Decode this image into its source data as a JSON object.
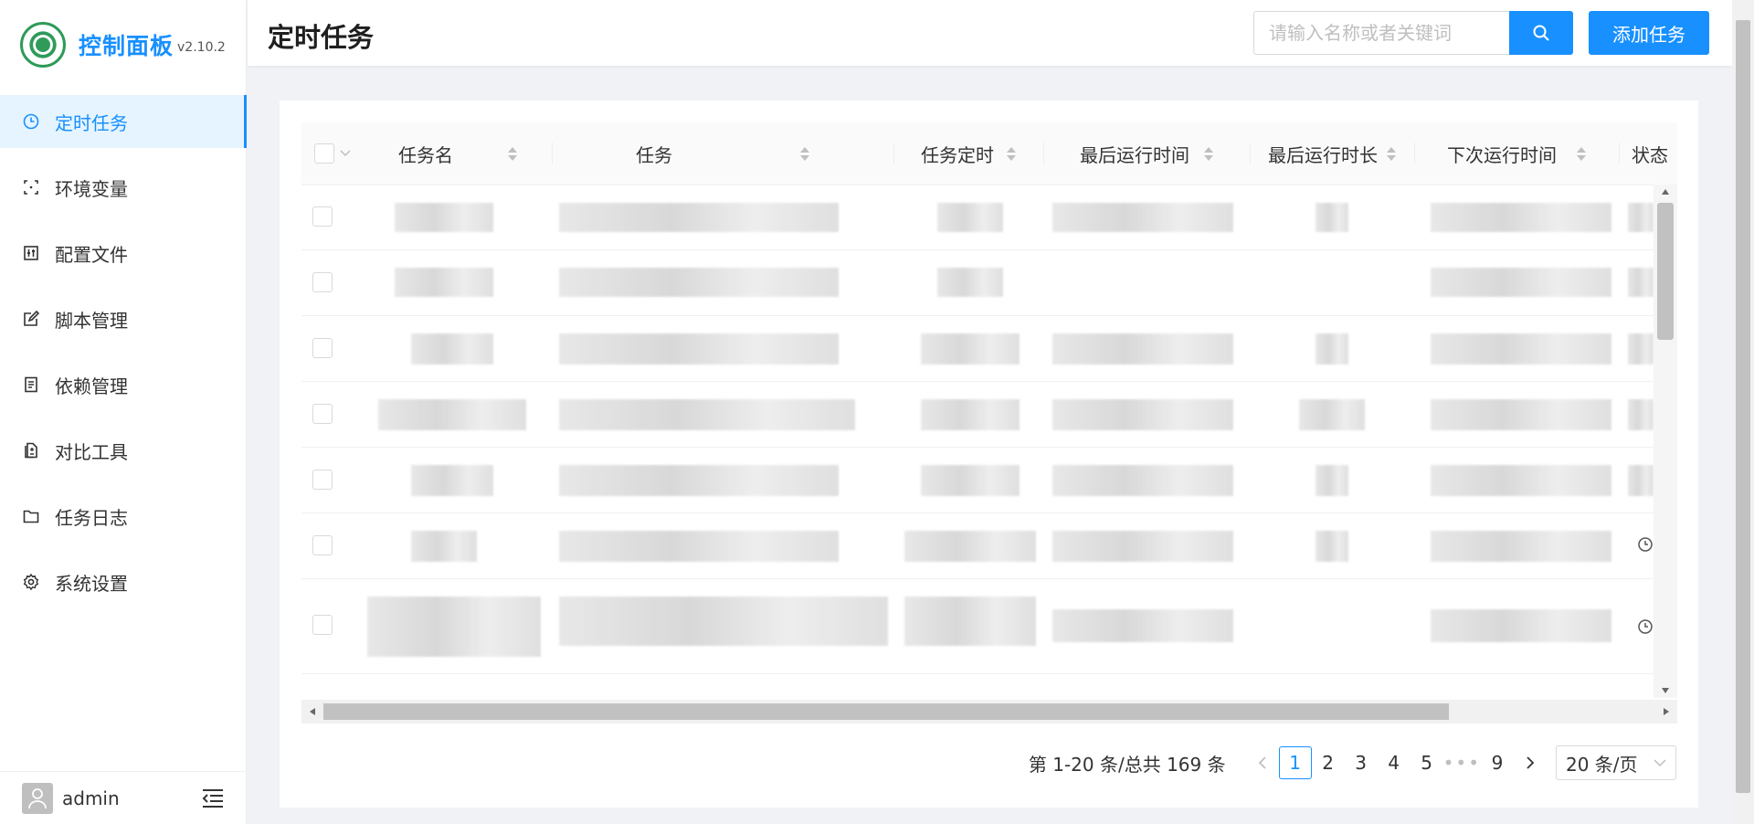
{
  "brand": {
    "title": "控制面板",
    "version": "v2.10.2"
  },
  "sidebar": {
    "items": [
      {
        "label": "定时任务",
        "icon": "clock-icon",
        "active": true
      },
      {
        "label": "环境变量",
        "icon": "variable-icon",
        "active": false
      },
      {
        "label": "配置文件",
        "icon": "sliders-icon",
        "active": false
      },
      {
        "label": "脚本管理",
        "icon": "edit-icon",
        "active": false
      },
      {
        "label": "依赖管理",
        "icon": "document-icon",
        "active": false
      },
      {
        "label": "对比工具",
        "icon": "diff-icon",
        "active": false
      },
      {
        "label": "任务日志",
        "icon": "folder-icon",
        "active": false
      },
      {
        "label": "系统设置",
        "icon": "gear-icon",
        "active": false
      }
    ],
    "user": "admin"
  },
  "header": {
    "title": "定时任务",
    "search_placeholder": "请输入名称或者关键词",
    "add_label": "添加任务"
  },
  "table": {
    "columns": [
      "任务名",
      "任务",
      "任务定时",
      "最后运行时间",
      "最后运行时长",
      "下次运行时间",
      "状态"
    ]
  },
  "pagination": {
    "total_text": "第 1-20 条/总共 169 条",
    "pages": [
      "1",
      "2",
      "3",
      "4",
      "5",
      "•••",
      "9"
    ],
    "current": "1",
    "page_size": "20 条/页"
  },
  "colors": {
    "primary": "#1890ff",
    "active_bg": "#e6f4ff"
  }
}
